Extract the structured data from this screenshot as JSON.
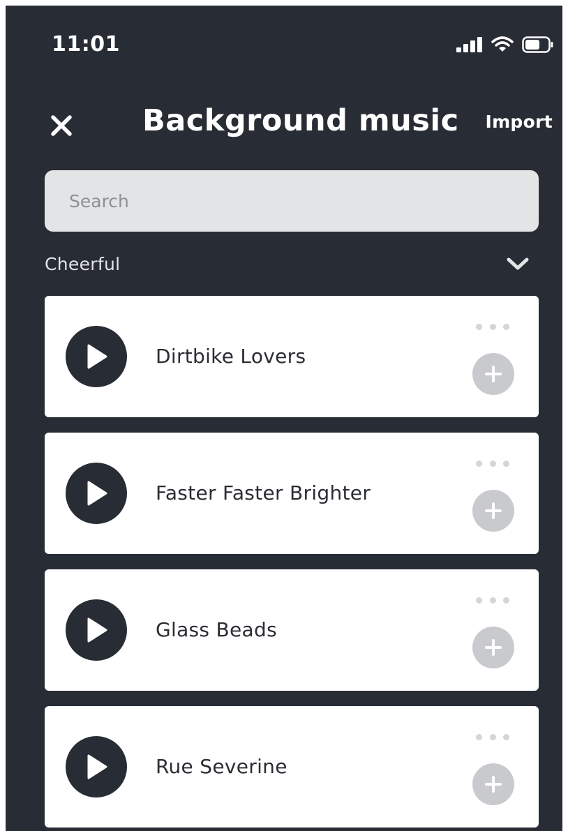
{
  "status_bar": {
    "time": "11:01",
    "icons": [
      "cellular-signal-icon",
      "wifi-icon",
      "battery-icon"
    ]
  },
  "header": {
    "close_icon": "close-icon",
    "title": "Background music",
    "import_label": "Import"
  },
  "search": {
    "placeholder": "Search",
    "value": ""
  },
  "category": {
    "label": "Cheerful",
    "toggle_icon": "chevron-down-icon"
  },
  "tracks": [
    {
      "name": "Dirtbike Lovers"
    },
    {
      "name": "Faster Faster Brighter"
    },
    {
      "name": "Glass Beads"
    },
    {
      "name": "Rue Severine"
    }
  ],
  "colors": {
    "background": "#282c34",
    "card": "#ffffff",
    "search_bg": "#e3e4e6",
    "add_button": "#c9cacd",
    "more_dots": "#d4d5d8"
  }
}
